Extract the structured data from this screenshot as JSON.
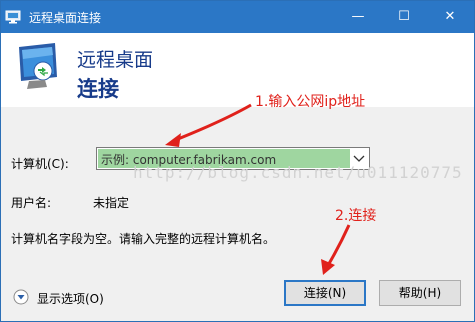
{
  "window": {
    "title": "远程桌面连接",
    "minimize_symbol": "—",
    "maximize_symbol": "☐",
    "close_symbol": "✕"
  },
  "header": {
    "line1": "远程桌面",
    "line2": "连接",
    "icon": "remote-desktop-monitor-icon"
  },
  "form": {
    "computer_label": "计算机(C):",
    "computer_placeholder": "示例: computer.fabrikam.com",
    "user_label": "用户名:",
    "user_value": "未指定",
    "info_text": "计算机名字段为空。请输入完整的远程计算机名。"
  },
  "annotations": {
    "step1": "1.输入公网ip地址",
    "step2": "2.连接",
    "color": "#e0211b"
  },
  "watermark": "http://blog.csdn.net/u011120775",
  "footer": {
    "options_label": "显示选项(O)",
    "connect_label": "连接(N)",
    "help_label": "帮助(H)"
  },
  "colors": {
    "titlebar": "#2b77c6",
    "header_text": "#173b8a",
    "combo_highlight": "#9fd6a0"
  }
}
